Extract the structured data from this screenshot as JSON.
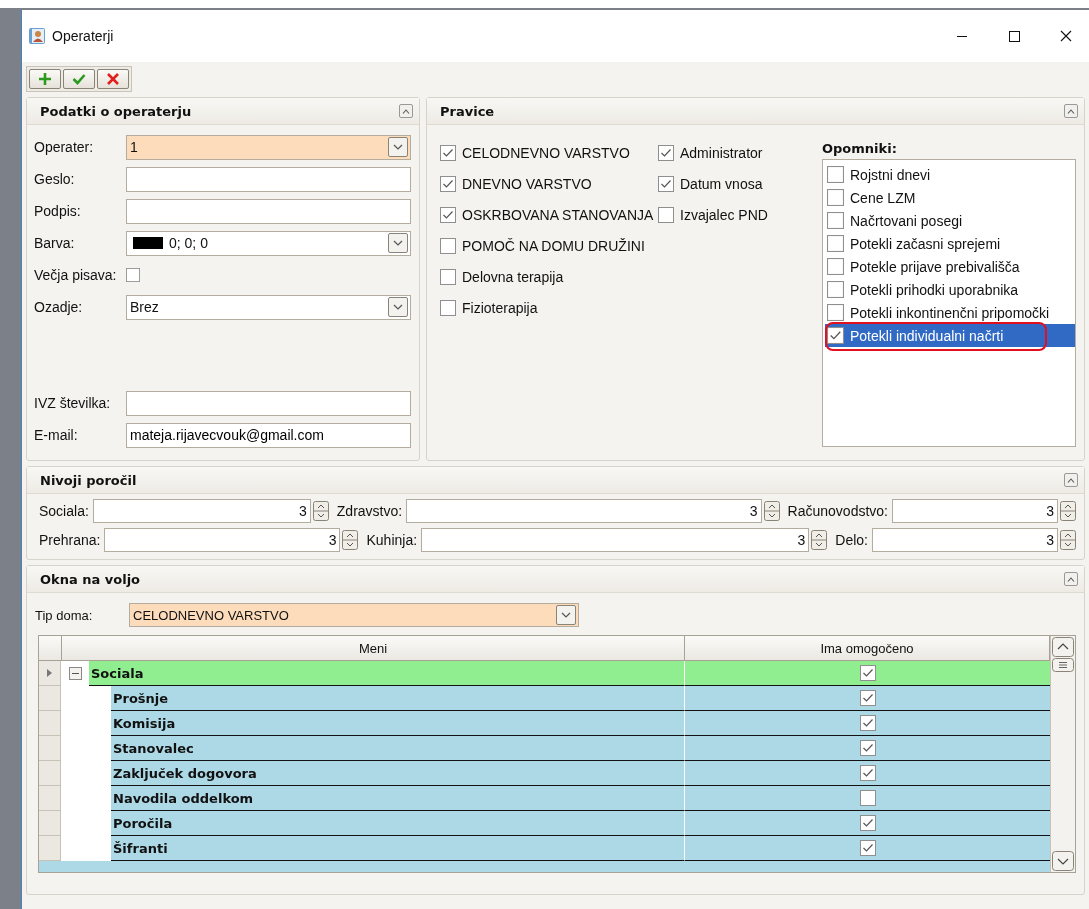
{
  "window": {
    "title": "Operaterji"
  },
  "toolbar": [
    {
      "kind": "add"
    },
    {
      "kind": "confirm"
    },
    {
      "kind": "cancel"
    }
  ],
  "operator_panel": {
    "title": "Podatki o operaterju",
    "fields": [
      {
        "kind": "combo",
        "label": "Operater:",
        "value": "1",
        "highlighted": true
      },
      {
        "kind": "text",
        "label": "Geslo:"
      },
      {
        "kind": "text",
        "label": "Podpis:"
      },
      {
        "kind": "color",
        "label": "Barva:",
        "value": "0; 0; 0",
        "color": "#000000"
      },
      {
        "kind": "check",
        "label": "Večja pisava:",
        "checked": false
      },
      {
        "kind": "combo",
        "label": "Ozadje:",
        "value": "Brez",
        "highlighted": false
      },
      {
        "kind": "gap"
      },
      {
        "kind": "text",
        "label": "IVZ številka:"
      },
      {
        "kind": "text",
        "label": "E-mail:",
        "value": "mateja.rijavecvouk@gmail.com"
      }
    ]
  },
  "rights_panel": {
    "title": "Pravice",
    "column_1": [
      {
        "label": "CELODNEVNO VARSTVO",
        "checked": true
      },
      {
        "label": "DNEVNO VARSTVO",
        "checked": true
      },
      {
        "label": "OSKRBOVANA STANOVANJA",
        "checked": true
      },
      {
        "label": "POMOČ NA DOMU DRUŽINI",
        "checked": false
      },
      {
        "label": "Delovna terapija",
        "checked": false
      },
      {
        "label": "Fizioterapija",
        "checked": false
      }
    ],
    "column_2": [
      {
        "label": "Administrator",
        "checked": true
      },
      {
        "label": "Datum vnosa",
        "checked": true
      },
      {
        "label": "Izvajalec PND",
        "checked": false
      }
    ],
    "reminders": {
      "title": "Opomniki:",
      "items": [
        {
          "label": "Rojstni dnevi",
          "checked": false,
          "selected": false,
          "circled": false
        },
        {
          "label": "Cene LZM",
          "checked": false,
          "selected": false,
          "circled": false
        },
        {
          "label": "Načrtovani posegi",
          "checked": false,
          "selected": false,
          "circled": false
        },
        {
          "label": "Potekli začasni sprejemi",
          "checked": false,
          "selected": false,
          "circled": false
        },
        {
          "label": "Potekle prijave prebivališča",
          "checked": false,
          "selected": false,
          "circled": false
        },
        {
          "label": "Potekli prihodki uporabnika",
          "checked": false,
          "selected": false,
          "circled": false
        },
        {
          "label": "Potekli inkontinenčni pripomočki",
          "checked": false,
          "selected": false,
          "circled": false
        },
        {
          "label": "Potekli individualni načrti",
          "checked": true,
          "selected": true,
          "circled": true
        }
      ]
    }
  },
  "report_levels": {
    "title": "Nivoji poročil",
    "rows": [
      [
        {
          "label": "Sociala:",
          "value": "3"
        },
        {
          "label": "Zdravstvo:",
          "value": "3"
        },
        {
          "label": "Računovodstvo:",
          "value": "3"
        }
      ],
      [
        {
          "label": "Prehrana:",
          "value": "3"
        },
        {
          "label": "Kuhinja:",
          "value": "3"
        },
        {
          "label": "Delo:",
          "value": "3"
        }
      ]
    ]
  },
  "panes": {
    "title": "Okna na voljo",
    "home_type": {
      "label": "Tip doma:",
      "value": "CELODNEVNO VARSTVO"
    },
    "columns": [
      "Meni",
      "Ima omogočeno"
    ],
    "rows": [
      {
        "label": "Sociala",
        "enabled": true,
        "selected": true,
        "expanded": true,
        "children": [
          {
            "label": "Prošnje",
            "enabled": true,
            "selected": false
          },
          {
            "label": "Komisija",
            "enabled": true,
            "selected": false
          },
          {
            "label": "Stanovalec",
            "enabled": true,
            "selected": false
          },
          {
            "label": "Zaključek dogovora",
            "enabled": true,
            "selected": false
          },
          {
            "label": "Navodila oddelkom",
            "enabled": false,
            "selected": false
          },
          {
            "label": "Poročila",
            "enabled": true,
            "selected": false
          },
          {
            "label": "Šifranti",
            "enabled": true,
            "selected": false
          }
        ]
      }
    ]
  }
}
